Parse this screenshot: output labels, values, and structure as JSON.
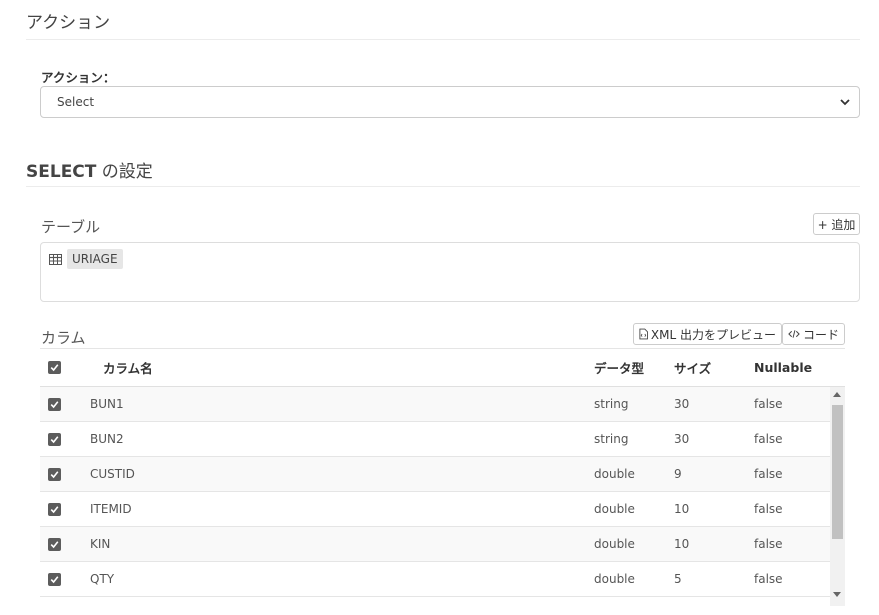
{
  "header": {
    "title": "アクション"
  },
  "action": {
    "label": "アクション：",
    "select_value": "Select"
  },
  "select_settings": {
    "title_bold": "SELECT",
    "title_rest": " の設定"
  },
  "tables": {
    "label": "テーブル",
    "add_button": "+ 追加",
    "items": [
      "URIAGE"
    ]
  },
  "columns": {
    "label": "カラム",
    "xml_preview_button": "XML 出力をプレビュー",
    "code_button": "コード",
    "headers": {
      "name": "カラム名",
      "type": "データ型",
      "size": "サイズ",
      "nullable": "Nullable"
    },
    "rows": [
      {
        "name": "BUN1",
        "type": "string",
        "size": "30",
        "nullable": "false",
        "checked": true
      },
      {
        "name": "BUN2",
        "type": "string",
        "size": "30",
        "nullable": "false",
        "checked": true
      },
      {
        "name": "CUSTID",
        "type": "double",
        "size": "9",
        "nullable": "false",
        "checked": true
      },
      {
        "name": "ITEMID",
        "type": "double",
        "size": "10",
        "nullable": "false",
        "checked": true
      },
      {
        "name": "KIN",
        "type": "double",
        "size": "10",
        "nullable": "false",
        "checked": true
      },
      {
        "name": "QTY",
        "type": "double",
        "size": "5",
        "nullable": "false",
        "checked": true
      }
    ]
  }
}
